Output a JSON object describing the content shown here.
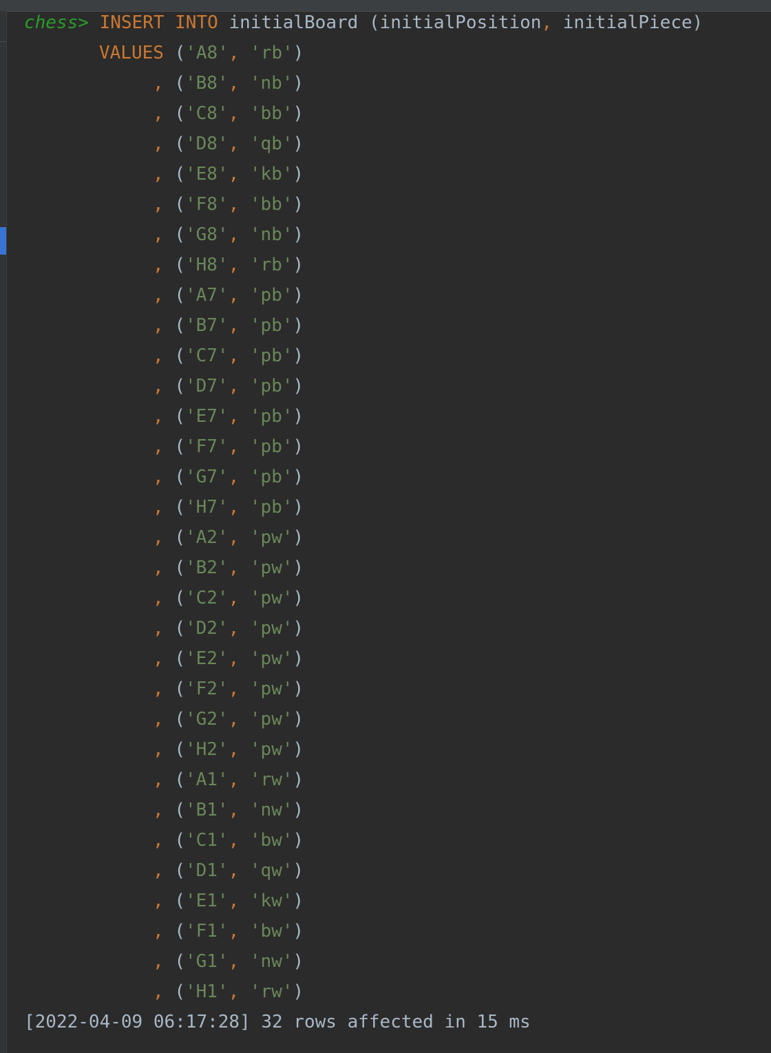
{
  "prompt": "chess>",
  "statement": {
    "insert_kw": "INSERT",
    "into_kw": "INTO",
    "table": "initialBoard",
    "col_open": "(initialPosition",
    "col_sep": ",",
    "col_close": "initialPiece)",
    "values_kw": "VALUES"
  },
  "rows": [
    {
      "position": "A8",
      "piece": "rb"
    },
    {
      "position": "B8",
      "piece": "nb"
    },
    {
      "position": "C8",
      "piece": "bb"
    },
    {
      "position": "D8",
      "piece": "qb"
    },
    {
      "position": "E8",
      "piece": "kb"
    },
    {
      "position": "F8",
      "piece": "bb"
    },
    {
      "position": "G8",
      "piece": "nb"
    },
    {
      "position": "H8",
      "piece": "rb"
    },
    {
      "position": "A7",
      "piece": "pb"
    },
    {
      "position": "B7",
      "piece": "pb"
    },
    {
      "position": "C7",
      "piece": "pb"
    },
    {
      "position": "D7",
      "piece": "pb"
    },
    {
      "position": "E7",
      "piece": "pb"
    },
    {
      "position": "F7",
      "piece": "pb"
    },
    {
      "position": "G7",
      "piece": "pb"
    },
    {
      "position": "H7",
      "piece": "pb"
    },
    {
      "position": "A2",
      "piece": "pw"
    },
    {
      "position": "B2",
      "piece": "pw"
    },
    {
      "position": "C2",
      "piece": "pw"
    },
    {
      "position": "D2",
      "piece": "pw"
    },
    {
      "position": "E2",
      "piece": "pw"
    },
    {
      "position": "F2",
      "piece": "pw"
    },
    {
      "position": "G2",
      "piece": "pw"
    },
    {
      "position": "H2",
      "piece": "pw"
    },
    {
      "position": "A1",
      "piece": "rw"
    },
    {
      "position": "B1",
      "piece": "nw"
    },
    {
      "position": "C1",
      "piece": "bw"
    },
    {
      "position": "D1",
      "piece": "qw"
    },
    {
      "position": "E1",
      "piece": "kw"
    },
    {
      "position": "F1",
      "piece": "bw"
    },
    {
      "position": "G1",
      "piece": "nw"
    },
    {
      "position": "H1",
      "piece": "rw"
    }
  ],
  "result": "[2022-04-09 06:17:28] 32 rows affected in 15 ms",
  "colors": {
    "background": "#2b2b2b",
    "prompt": "#2a9c2a",
    "keyword": "#cc7832",
    "identifier": "#a9b7c6",
    "string": "#6a8759",
    "active_marker": "#3a73d6"
  }
}
